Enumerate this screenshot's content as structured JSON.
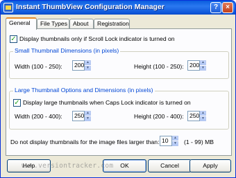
{
  "window": {
    "title": "Instant ThumbView Configuration Manager",
    "help_button": "?",
    "close_button": "×"
  },
  "tabs": [
    {
      "label": "General",
      "active": true
    },
    {
      "label": "File Types",
      "active": false
    },
    {
      "label": "About",
      "active": false
    },
    {
      "label": "Registration",
      "active": false
    }
  ],
  "general": {
    "scroll_lock_checkbox": {
      "label": "Display thumbnails only if Scroll Lock indicator is turned on",
      "checked": true,
      "mark": "✓"
    },
    "small_group": {
      "title": "Small Thumbnail Dimensions (in pixels)",
      "width_label": "Width  (100 - 250):",
      "width_value": "200",
      "height_label": "Height  (100 - 250):",
      "height_value": "200"
    },
    "large_group": {
      "title": "Large Thumbnail Options and Dimensions (in pixels)",
      "caps_lock_checkbox": {
        "label": "Display large thumbnails when Caps Lock indicator is turned on",
        "checked": true,
        "mark": "✓"
      },
      "width_label": "Width  (200 - 400):",
      "width_value": "250",
      "height_label": "Height  (200 - 400):",
      "height_value": "250"
    },
    "max_size": {
      "label": "Do not display thumbnails for the image files larger than:",
      "value": "10",
      "range": "(1 - 99) MB"
    }
  },
  "spinner_glyphs": {
    "up": "▲",
    "down": "▼"
  },
  "buttons": {
    "help": "Help",
    "ok": "OK",
    "cancel": "Cancel",
    "apply": "Apply"
  },
  "watermark": "www.versiontracker.com"
}
